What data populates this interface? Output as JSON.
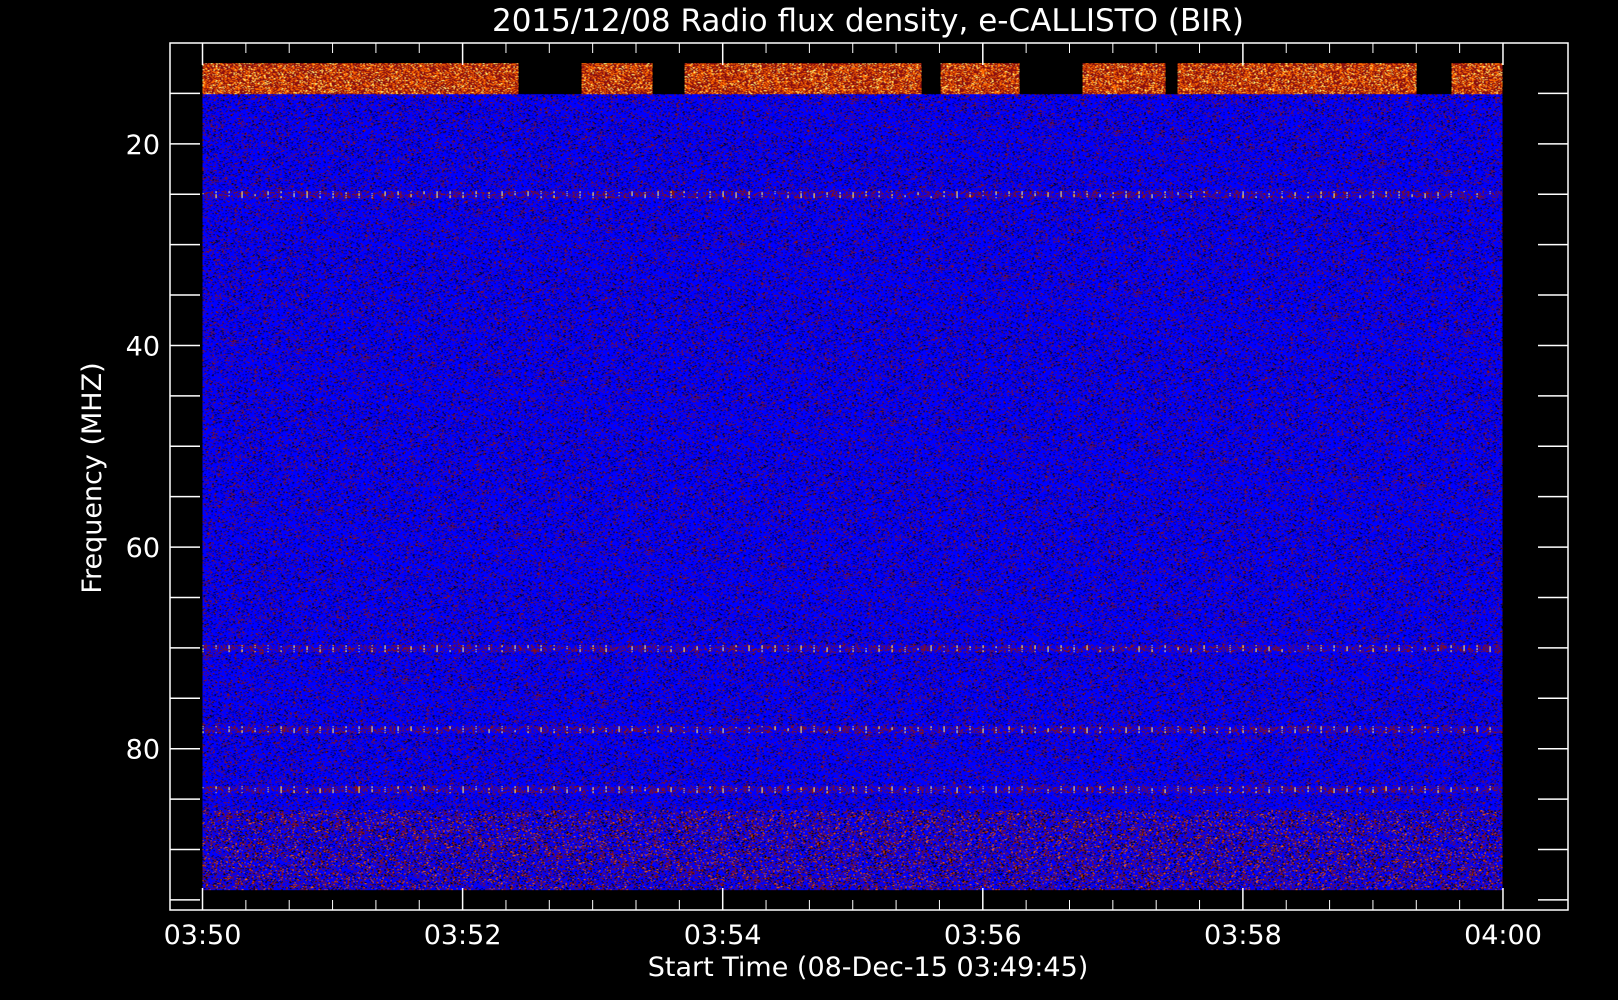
{
  "chart_data": {
    "type": "heatmap",
    "title": "2015/12/08  Radio flux density, e-CALLISTO (BIR)",
    "xlabel": "Start Time (08-Dec-15 03:49:45)",
    "ylabel": "Frequency (MHZ)",
    "x_ticks": [
      "03:50",
      "03:52",
      "03:54",
      "03:56",
      "03:58",
      "04:00"
    ],
    "y_ticks": [
      20,
      40,
      60,
      80
    ],
    "xlim": [
      "03:49:45",
      "04:00:30"
    ],
    "ylim": [
      10,
      96
    ],
    "data_time_range": [
      "03:50:00",
      "04:00:00"
    ],
    "data_freq_range": [
      12,
      94
    ],
    "colormap": {
      "background": "#0000ff",
      "mid": "#8a1010",
      "high": "#ff6a00",
      "peak": "#ffff80",
      "gap": "#000000"
    },
    "features": [
      {
        "type": "intense-band",
        "freq_range": [
          12,
          15
        ],
        "note": "strong emission along top band"
      },
      {
        "type": "dotted-line",
        "freq": 25
      },
      {
        "type": "dotted-line",
        "freq": 70
      },
      {
        "type": "dotted-line",
        "freq": 78
      },
      {
        "type": "dotted-line",
        "freq": 84
      },
      {
        "type": "noisy-band",
        "freq_range": [
          86,
          94
        ]
      }
    ],
    "grid": false,
    "legend": "none"
  },
  "colors": {
    "page_background": "#000000",
    "axis": "#ffffff",
    "text": "#ffffff"
  }
}
